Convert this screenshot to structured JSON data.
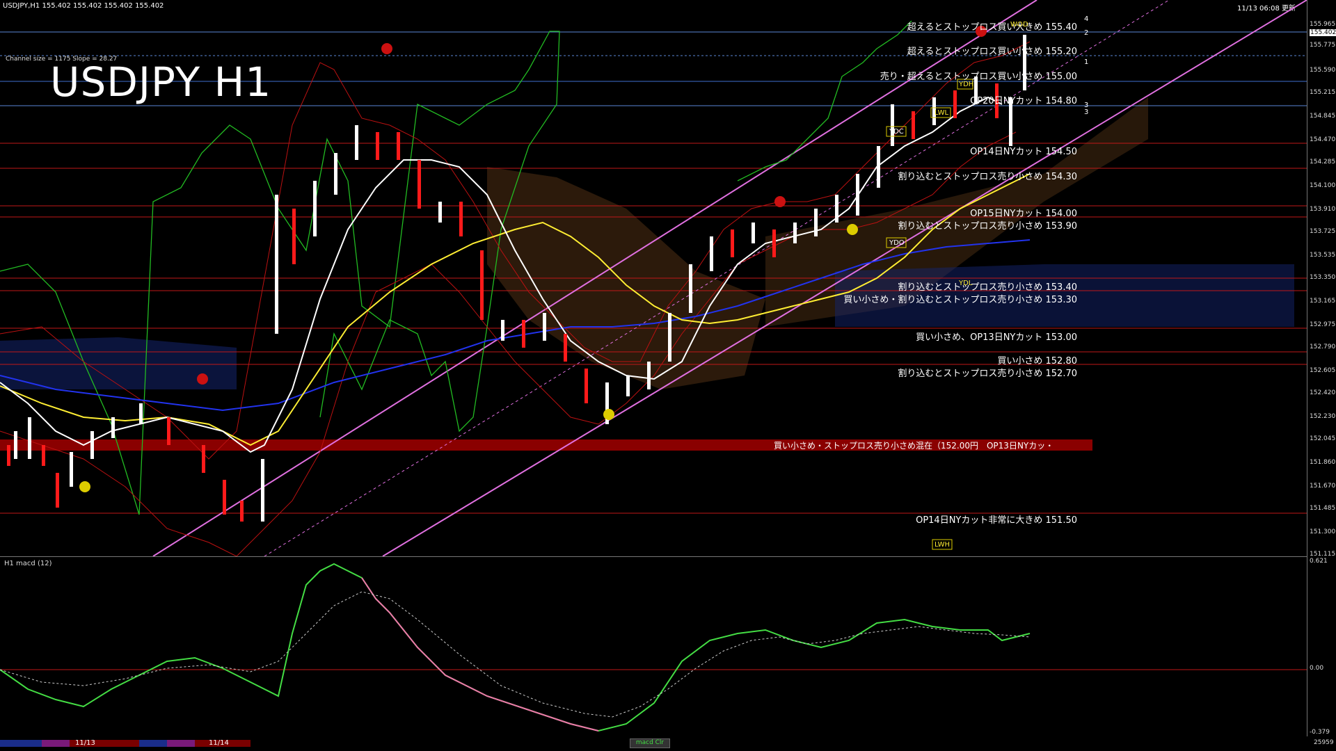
{
  "header": {
    "symbol_info": "USDJPY,H1  155.402 155.402 155.402 155.402",
    "datetime": "11/13 06:08 更新"
  },
  "main": {
    "title": "USDJPY H1",
    "channel_info": "Channel size = 1175 Slope = 28.27",
    "current_price": "155.402",
    "price_scale": [
      "155.965",
      "155.775",
      "155.590",
      "155.400",
      "155.215",
      "155.030",
      "154.845",
      "154.660",
      "154.470",
      "154.285",
      "154.100",
      "153.910",
      "153.725",
      "153.535",
      "153.350",
      "153.165",
      "152.975",
      "152.790",
      "152.605",
      "152.420",
      "152.230",
      "152.045",
      "151.860",
      "151.670",
      "151.485",
      "151.300",
      "151.115"
    ],
    "levels": [
      {
        "label": "超えるとストップロス買い大きめ 155.40",
        "color": "#5a86d6"
      },
      {
        "label": "超えるとストップロス買い小さめ 155.20",
        "color": "#5a86d6"
      },
      {
        "label": "売り・超えるとストップロス買い小さめ 155.00",
        "color": "#3f6fd0"
      },
      {
        "label": "OP20日NYカット 154.80",
        "color": "#5a86d6"
      },
      {
        "label": "OP14日NYカット 154.50",
        "color": "#c01818"
      },
      {
        "label": "割り込むとストップロス売り小さめ 154.30",
        "color": "#c01818"
      },
      {
        "label": "OP15日NYカット 154.00",
        "color": "#c01818"
      },
      {
        "label": "割り込むとストップロス売り小さめ 153.90",
        "color": "#c01818"
      },
      {
        "label": "割り込むとストップロス売り小さめ 153.40",
        "color": "#c01818"
      },
      {
        "label": "買い小さめ・割り込むとストップロス売り小さめ 153.30",
        "color": "#c01818"
      },
      {
        "label": "買い小さめ、OP13日NYカット 153.00",
        "color": "#c01818"
      },
      {
        "label": "買い小さめ 152.80",
        "color": "#c01818"
      },
      {
        "label": "割り込むとストップロス売り小さめ 152.70",
        "color": "#c01818"
      },
      {
        "label": "OP14日NYカット非常に大きめ 151.50",
        "color": "#c01818"
      }
    ],
    "band_label": "買い小さめ・ストップロス売り小さめ混在（152.00円　OP13日NYカッ・",
    "channel_numbers": [
      "4",
      "2",
      "1",
      "3",
      "3"
    ],
    "markers": [
      "YDH",
      "YDC",
      "YDO",
      "YDL",
      "LWL",
      "LWH",
      "WO",
      "D"
    ]
  },
  "macd": {
    "label": "H1  macd (12)",
    "scale": [
      "0.621",
      "0.00",
      "-0.379"
    ],
    "footer_label": "macd Clr"
  },
  "bottom": {
    "dates": [
      "11/13",
      "11/14"
    ],
    "count": "25959"
  },
  "colors": {
    "background": "#000000",
    "bull": "#ffffff",
    "bear": "#ff1a1a",
    "ma_white": "#ffffff",
    "ma_yellow": "#ffee33",
    "ma_blue": "#2222ee",
    "chikou": "#22bb22",
    "channel": "#e070e0",
    "band": "#8a0000",
    "macd_up": "#44dd44",
    "macd_down": "#ee77aa"
  }
}
